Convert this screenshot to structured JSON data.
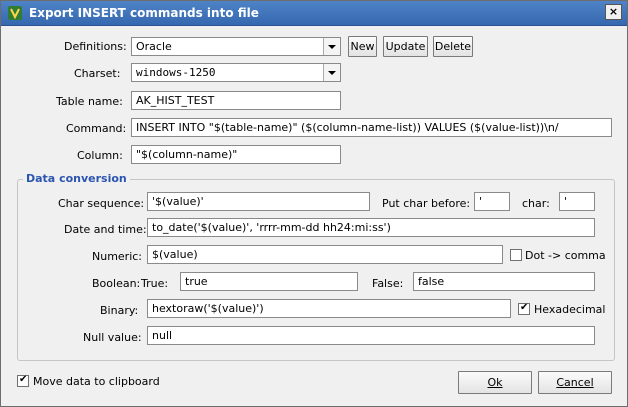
{
  "window": {
    "title": "Export INSERT commands into file",
    "close": "×"
  },
  "form": {
    "definitions_label": "Definitions:",
    "definitions_value": "Oracle",
    "new_label": "New",
    "update_label": "Update",
    "delete_label": "Delete",
    "charset_label": "Charset:",
    "charset_value": "windows-1250",
    "table_name_label": "Table name:",
    "table_name_value": "AK_HIST_TEST",
    "command_label": "Command:",
    "command_value": "INSERT INTO \"$(table-name)\" ($(column-name-list)) VALUES ($(value-list))\\n/",
    "column_label": "Column:",
    "column_value": "\"$(column-name)\""
  },
  "data_conversion": {
    "title": "Data conversion",
    "char_sequence_label": "Char sequence:",
    "char_sequence_value": "'$(value)'",
    "put_char_before_label": "Put char before:",
    "put_char_before_value": "'",
    "char_label": "char:",
    "char_value": "'",
    "date_time_label": "Date and time:",
    "date_time_value": "to_date('$(value)', 'rrrr-mm-dd hh24:mi:ss')",
    "numeric_label": "Numeric:",
    "numeric_value": "$(value)",
    "dot_comma_label": "Dot -> comma",
    "dot_comma_checked": false,
    "boolean_label": "Boolean:",
    "true_label": "True:",
    "true_value": "true",
    "false_label": "False:",
    "false_value": "false",
    "binary_label": "Binary:",
    "binary_value": "hextoraw('$(value)')",
    "hexadecimal_label": "Hexadecimal",
    "hexadecimal_checked": true,
    "null_value_label": "Null value:",
    "null_value_value": "null"
  },
  "footer": {
    "clipboard_label": "Move data to clipboard",
    "clipboard_checked": true,
    "ok_label": "Ok",
    "cancel_label": "Cancel"
  }
}
